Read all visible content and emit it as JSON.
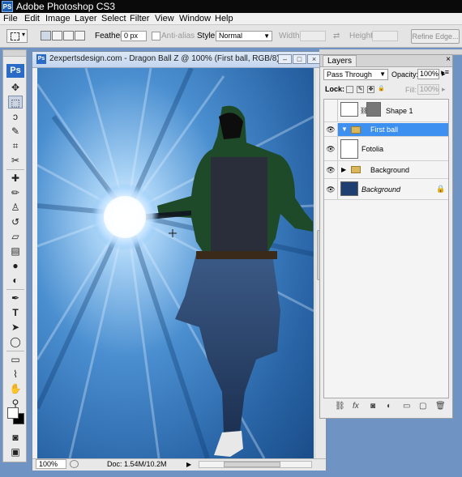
{
  "app": {
    "title": "Adobe Photoshop CS3",
    "icon": "PS"
  },
  "menu": [
    "File",
    "Edit",
    "Image",
    "Layer",
    "Select",
    "Filter",
    "View",
    "Window",
    "Help"
  ],
  "options": {
    "feather_label": "Feather:",
    "feather_value": "0 px",
    "antialias_label": "Anti-alias",
    "style_label": "Style:",
    "style_value": "Normal",
    "width_label": "Width:",
    "height_label": "Height:",
    "refine_label": "Refine Edge..."
  },
  "toolbox": {
    "logo": "Ps",
    "tools": [
      "move-tool",
      "marquee-tool",
      "lasso-tool",
      "quick-select-tool",
      "crop-tool",
      "slice-tool",
      "healing-tool",
      "brush-tool",
      "stamp-tool",
      "history-brush-tool",
      "eraser-tool",
      "gradient-tool",
      "blur-tool",
      "dodge-tool",
      "pen-tool",
      "type-tool",
      "path-select-tool",
      "shape-tool",
      "notes-tool",
      "eyedropper-tool",
      "hand-tool",
      "zoom-tool"
    ]
  },
  "document": {
    "title": "2expertsdesign.com - Dragon Ball Z @ 100% (First ball, RGB/8)",
    "zoom": "100%",
    "doc_size": "Doc: 1.54M/10.2M"
  },
  "layers_panel": {
    "tab": "Layers",
    "close": "×",
    "blend_mode": "Pass Through",
    "opacity_label": "Opacity:",
    "opacity_value": "100%",
    "lock_label": "Lock:",
    "fill_label": "Fill:",
    "fill_value": "100%",
    "layers": [
      {
        "name": "Shape 1",
        "visible": false,
        "selected": false,
        "type": "shape"
      },
      {
        "name": "First ball",
        "visible": true,
        "selected": true,
        "type": "group"
      },
      {
        "name": "Fotolia",
        "visible": true,
        "selected": false,
        "type": "image"
      },
      {
        "name": "Background",
        "visible": true,
        "selected": false,
        "type": "group"
      },
      {
        "name": "Background",
        "visible": true,
        "selected": false,
        "type": "background",
        "locked": true
      }
    ]
  },
  "colors": {
    "workspace": "#6f93c2",
    "selection": "#3d8ff0",
    "canvas_blue": "#2d6fb0"
  }
}
